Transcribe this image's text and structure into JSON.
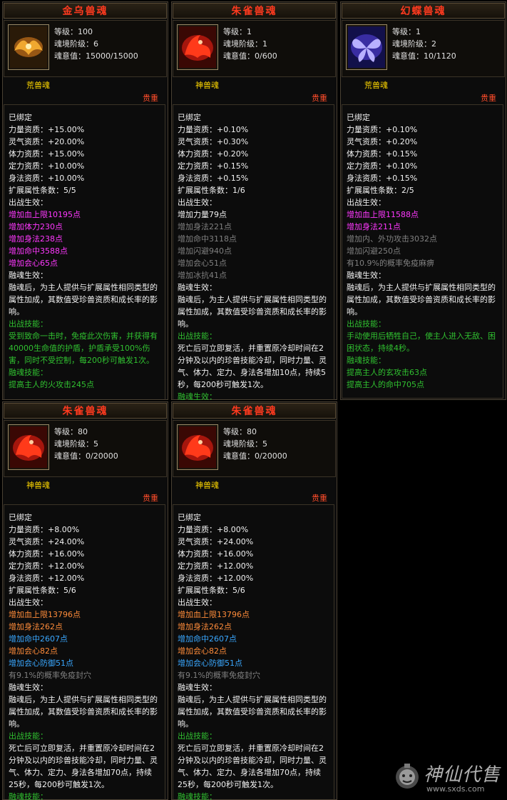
{
  "cards": [
    {
      "title": "金乌兽魂",
      "level": "等级：100",
      "tier": "魂境阶级：6",
      "soul_value": "魂意值：15000/15000",
      "soul_type": "荒兽魂",
      "rarity": "贵重",
      "bound": "已绑定",
      "attrs": [
        "力量资质：+15.00%",
        "灵气资质：+20.00%",
        "体力资质：+15.00%",
        "定力资质：+10.00%",
        "身法资质：+10.00%"
      ],
      "ext_count": "扩展属性条数：5/5",
      "battle_effect_label": "出战生效：",
      "ext_lines": [
        {
          "text": "增加血上限10195点",
          "color": "p"
        },
        {
          "text": "增加体力230点",
          "color": "p"
        },
        {
          "text": "增加身法238点",
          "color": "p"
        },
        {
          "text": "增加命中3588点",
          "color": "p"
        },
        {
          "text": "增加会心65点",
          "color": "p"
        }
      ],
      "fuse_label": "融魂生效：",
      "fuse_text": "融魂后，为主人提供与扩展属性相同类型的属性加成，其数值受珍兽资质和成长率的影响。",
      "skill_label": "出战技能：",
      "skill_text": "受到致命一击时，免疫此次伤害，并获得有40000生命值的护盾，护盾承受100%伤害，同时不受控制，每200秒可触发1次。",
      "fuse_skill_label": "融魂技能：",
      "fuse_skill_text": "提高主人的火攻击245点"
    },
    {
      "title": "朱雀兽魂",
      "level": "等级：1",
      "tier": "魂境阶级：1",
      "soul_value": "魂意值：0/600",
      "soul_type": "神兽魂",
      "rarity": "贵重",
      "bound": "已绑定",
      "attrs": [
        "力量资质：+0.10%",
        "灵气资质：+0.30%",
        "体力资质：+0.20%",
        "定力资质：+0.15%",
        "身法资质：+0.15%"
      ],
      "ext_count": "扩展属性条数：1/6",
      "battle_effect_label": "出战生效：",
      "ext_lines": [
        {
          "text": "增加力量79点",
          "color": "w"
        },
        {
          "text": "增加身法221点",
          "color": "gr"
        },
        {
          "text": "增加命中3118点",
          "color": "gr"
        },
        {
          "text": "增加闪避940点",
          "color": "gr"
        },
        {
          "text": "增加会心51点",
          "color": "gr"
        },
        {
          "text": "增加冰抗41点",
          "color": "gr"
        }
      ],
      "fuse_label": "融魂生效：",
      "fuse_text": "融魂后，为主人提供与扩展属性相同类型的属性加成，其数值受珍兽资质和成长率的影响。",
      "skill_label": "出战技能：",
      "skill_text": "死亡后可立即复活，并重置原冷却时间在2分钟及以内的珍兽技能冷却，同时力量、灵气、体力、定力、身法各增加10点，持续5秒，每200秒可触发1次。",
      "fuse_skill_label": "融魂生效：",
      "fuse_skill_text": ""
    },
    {
      "title": "幻蝶兽魂",
      "level": "等级：1",
      "tier": "魂境阶级：2",
      "soul_value": "魂意值：10/1120",
      "soul_type": "荒兽魂",
      "rarity": "贵重",
      "bound": "已绑定",
      "attrs": [
        "力量资质：+0.10%",
        "灵气资质：+0.20%",
        "体力资质：+0.15%",
        "定力资质：+0.10%",
        "身法资质：+0.15%"
      ],
      "ext_count": "扩展属性条数：2/5",
      "battle_effect_label": "出战生效：",
      "ext_lines": [
        {
          "text": "增加血上限11588点",
          "color": "p"
        },
        {
          "text": "增加身法211点",
          "color": "p"
        },
        {
          "text": "增加内、外功攻击3032点",
          "color": "gr"
        },
        {
          "text": "增加闪避250点",
          "color": "gr"
        },
        {
          "text": "有10.9%的概率免疫麻痹",
          "color": "gr"
        }
      ],
      "fuse_label": "融魂生效：",
      "fuse_text": "融魂后，为主人提供与扩展属性相同类型的属性加成，其数值受珍兽资质和成长率的影响。",
      "skill_label": "出战技能：",
      "skill_text": "手动使用后牺牲自己，使主人进入无敌、困困状态，持续4秒。",
      "fuse_skill_label": "融魂技能：",
      "fuse_skill_text": "提高主人的玄攻击63点",
      "fuse_skill_text2": "提高主人的命中705点"
    },
    {
      "title": "朱雀兽魂",
      "level": "等级：80",
      "tier": "魂境阶级：5",
      "soul_value": "魂意值：0/20000",
      "soul_type": "神兽魂",
      "rarity": "贵重",
      "bound": "已绑定",
      "attrs": [
        "力量资质：+8.00%",
        "灵气资质：+24.00%",
        "体力资质：+16.00%",
        "定力资质：+12.00%",
        "身法资质：+12.00%"
      ],
      "ext_count": "扩展属性条数：5/6",
      "battle_effect_label": "出战生效：",
      "ext_lines": [
        {
          "text": "增加血上限13796点",
          "color": "o"
        },
        {
          "text": "增加身法262点",
          "color": "o"
        },
        {
          "text": "增加命中2607点",
          "color": "b"
        },
        {
          "text": "增加会心82点",
          "color": "o"
        },
        {
          "text": "增加会心防御51点",
          "color": "b"
        },
        {
          "text": "有9.1%的概率免疫封穴",
          "color": "gr"
        }
      ],
      "fuse_label": "融魂生效：",
      "fuse_text": "融魂后，为主人提供与扩展属性相同类型的属性加成，其数值受珍兽资质和成长率的影响。",
      "skill_label": "出战技能：",
      "skill_text": "死亡后可立即复活，并重置原冷却时间在2分钟及以内的珍兽技能冷却，同时力量、灵气、体力、定力、身法各增加70点，持续25秒，每200秒可触发1次。",
      "fuse_skill_label": "融魂技能：",
      "fuse_skill_text": ""
    },
    {
      "title": "朱雀兽魂",
      "level": "等级：80",
      "tier": "魂境阶级：5",
      "soul_value": "魂意值：0/20000",
      "soul_type": "神兽魂",
      "rarity": "贵重",
      "bound": "已绑定",
      "attrs": [
        "力量资质：+8.00%",
        "灵气资质：+24.00%",
        "体力资质：+16.00%",
        "定力资质：+12.00%",
        "身法资质：+12.00%"
      ],
      "ext_count": "扩展属性条数：5/6",
      "battle_effect_label": "出战生效：",
      "ext_lines": [
        {
          "text": "增加血上限13796点",
          "color": "o"
        },
        {
          "text": "增加身法262点",
          "color": "o"
        },
        {
          "text": "增加命中2607点",
          "color": "b"
        },
        {
          "text": "增加会心82点",
          "color": "o"
        },
        {
          "text": "增加会心防御51点",
          "color": "b"
        },
        {
          "text": "有9.1%的概率免疫封穴",
          "color": "gr"
        }
      ],
      "fuse_label": "融魂生效：",
      "fuse_text": "融魂后，为主人提供与扩展属性相同类型的属性加成，其数值受珍兽资质和成长率的影响。",
      "skill_label": "出战技能：",
      "skill_text": "死亡后可立即复活，并重置原冷却时间在2分钟及以内的珍兽技能冷却，同时力量、灵气、体力、定力、身法各增加70点，持续25秒，每200秒可触发1次。",
      "fuse_skill_label": "融魂技能：",
      "fuse_skill_text": ""
    }
  ],
  "watermark": {
    "text": "神仙代售",
    "url": "www.sxds.com"
  },
  "colors": {
    "title": "#ff3a1f",
    "soul_type": "#ffd800",
    "rarity": "#ff4d2a",
    "green": "#30c030",
    "purple": "#ff38ff",
    "orange": "#ff8c3a",
    "blue": "#3aa8ff",
    "gray": "#808080"
  }
}
